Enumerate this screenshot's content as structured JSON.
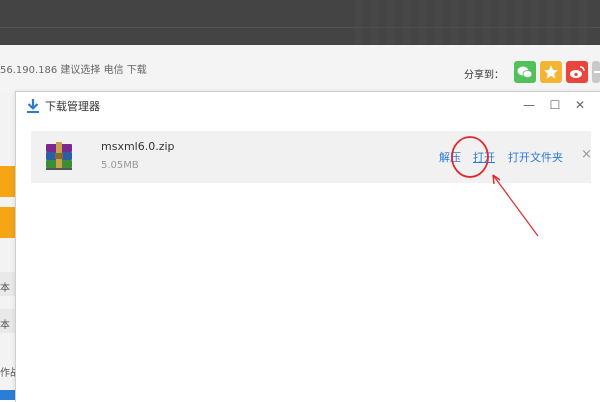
{
  "background_page": {
    "ip_line": "56.190.186 建议选择 电信 下载",
    "share_label": "分享到：",
    "share_buttons": [
      "wechat-icon",
      "qzone-star-icon",
      "weibo-icon",
      "more-icon"
    ],
    "left_fragments": [
      "本",
      "本",
      "作战"
    ]
  },
  "dialog": {
    "title": "下载管理器",
    "controls": {
      "minimize": "—",
      "maximize": "☐",
      "close": "✕"
    }
  },
  "download_item": {
    "file_name": "msxml6.0.zip",
    "file_size": "5.05MB",
    "actions": {
      "extract": "解压",
      "open": "打开",
      "open_folder": "打开文件夹",
      "remove": "×"
    }
  },
  "colors": {
    "accent_link": "#2a7bd8",
    "annotation_red": "#e0282e",
    "sidebar_orange": "#f5a614",
    "topbar": "#444444"
  }
}
